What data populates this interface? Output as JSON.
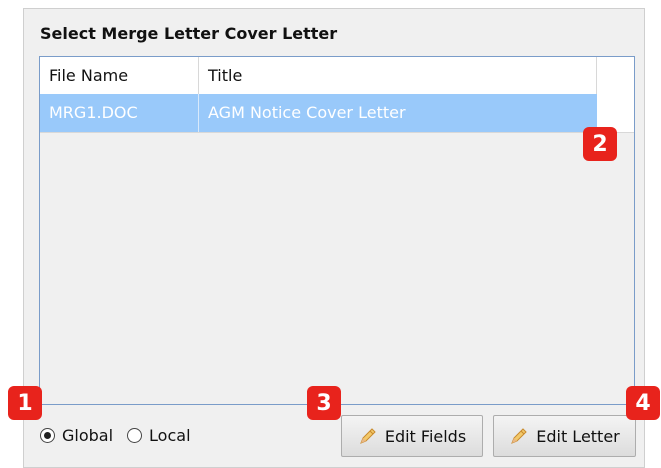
{
  "heading": "Select Merge Letter Cover Letter",
  "grid": {
    "columns": [
      "File Name",
      "Title"
    ],
    "rows": [
      {
        "file_name": "MRG1.DOC",
        "title": "AGM Notice Cover Letter",
        "selected": true
      }
    ]
  },
  "scope": {
    "options": [
      {
        "label": "Global",
        "checked": true
      },
      {
        "label": "Local",
        "checked": false
      }
    ]
  },
  "buttons": {
    "edit_fields": {
      "label": "Edit Fields",
      "icon": "pencil-icon"
    },
    "edit_letter": {
      "label": "Edit Letter",
      "icon": "pencil-icon"
    }
  },
  "callouts": [
    "1",
    "2",
    "3",
    "4"
  ],
  "colors": {
    "selection": "#99c9fa",
    "callout": "#e8231c",
    "grid_border": "#7a9cc9"
  }
}
